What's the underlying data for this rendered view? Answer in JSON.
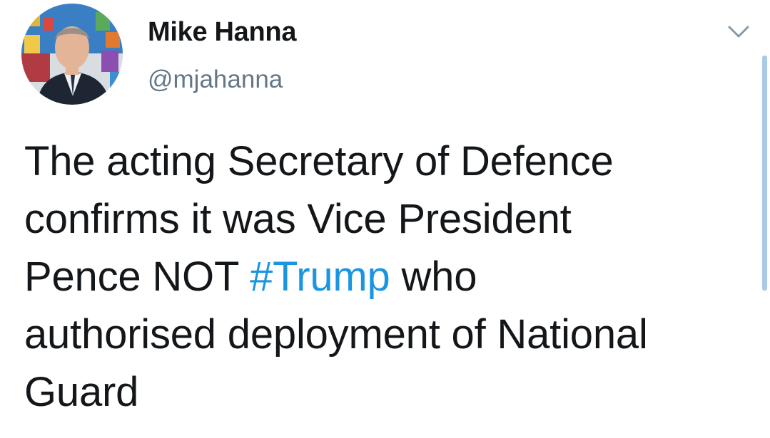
{
  "author": {
    "display_name": "Mike Hanna",
    "handle": "@mjahanna"
  },
  "tweet": {
    "line1": "The acting Secretary of Defence",
    "line2": "confirms it was Vice President",
    "line3_before": "Pence NOT ",
    "hashtag": "#Trump",
    "line3_after": " who",
    "line4": "authorised deployment of National",
    "line5": "Guard"
  },
  "icons": {
    "menu": "chevron-down-icon",
    "avatar": "avatar"
  },
  "colors": {
    "text": "#14171a",
    "secondary": "#657786",
    "link": "#1b95e0",
    "scrollbar": "#a9c9e8"
  }
}
